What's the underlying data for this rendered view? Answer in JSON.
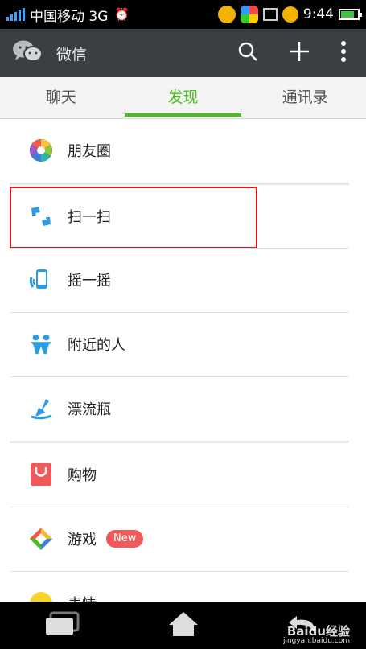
{
  "status_bar": {
    "carrier_text": "中国移动 3G",
    "time": "9:44",
    "signal_color": "#36a3ff",
    "battery_level": 0.8
  },
  "action_bar": {
    "app_icon": "wechat-icon",
    "title": "微信",
    "actions": [
      "search-icon",
      "add-icon",
      "overflow-menu-icon"
    ]
  },
  "tabs": [
    {
      "label": "聊天",
      "active": false
    },
    {
      "label": "发现",
      "active": true
    },
    {
      "label": "通讯录",
      "active": false
    }
  ],
  "accent_color": "#45c01a",
  "discover_items": [
    {
      "label": "朋友圈",
      "icon": "moments-icon"
    },
    {
      "label": "扫一扫",
      "icon": "scan-icon",
      "highlighted": true
    },
    {
      "label": "摇一摇",
      "icon": "shake-icon"
    },
    {
      "label": "附近的人",
      "icon": "people-nearby-icon"
    },
    {
      "label": "漂流瓶",
      "icon": "drift-bottle-icon"
    },
    {
      "label": "购物",
      "icon": "shopping-icon"
    },
    {
      "label": "游戏",
      "icon": "games-icon",
      "badge": "New"
    },
    {
      "label": "表情",
      "icon": "stickers-icon"
    }
  ],
  "nav_bar": {
    "buttons": [
      "recent-apps-icon",
      "home-icon",
      "back-icon"
    ]
  },
  "watermark": {
    "text": "Baidu经验",
    "sub": "jingyan.baidu.com"
  }
}
